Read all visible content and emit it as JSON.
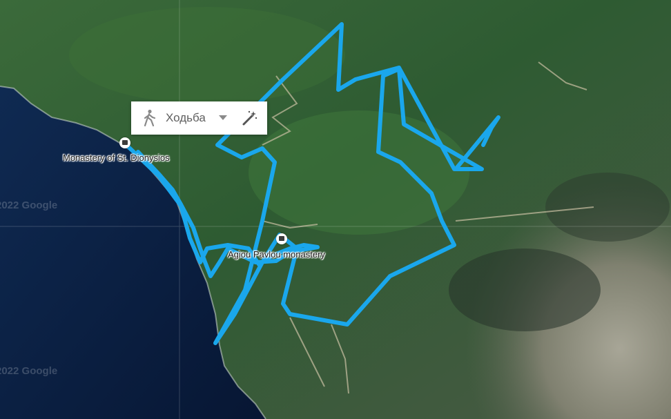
{
  "mode_selector": {
    "mode_label": "Ходьба",
    "walk_icon": "pedestrian-icon",
    "dropdown_icon": "caret-down-icon",
    "tool_icon": "magic-wand-icon"
  },
  "places": [
    {
      "name": "Monastery of St. Dionysios",
      "icon": "monastery-marker-icon"
    },
    {
      "name": "Agiou Pavlou monastery",
      "icon": "monastery-marker-icon"
    }
  ],
  "watermarks": [
    "2022 Google",
    "2022 Google"
  ],
  "colors": {
    "route": "#1aa7ec",
    "sea": "#0b1f3f",
    "land": "#2f5a36",
    "grid": "#ffffff"
  }
}
